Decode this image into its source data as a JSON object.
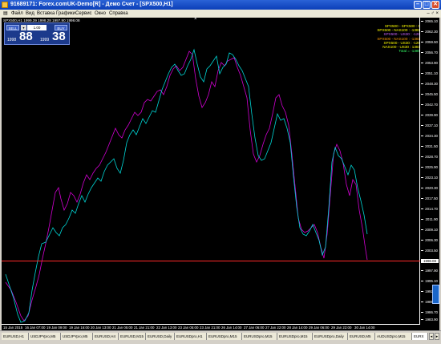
{
  "window": {
    "title": "91689171: Forex.comUK-Demo[R] - Демо Счет - [SPX500,H1]",
    "minimize": "–",
    "maximize": "□",
    "close": "✕"
  },
  "menu": {
    "items": [
      "Файл",
      "Вид",
      "Вставка",
      "Графики",
      "Сервис",
      "Окно",
      "Справка"
    ],
    "right": "– ♂ ×"
  },
  "chart": {
    "header": "SPX500,H1  1999.39 1998.28 1997.90 1998.08",
    "close_x": "×",
    "trade_panel": {
      "sell_label": "SELL",
      "buy_label": "BUY",
      "lot": "1.00",
      "lot_arrow": "▾",
      "sell_prefix": "1998",
      "sell_big": "88",
      "buy_prefix": "1999",
      "buy_big": "38"
    },
    "legend": [
      "SPX500 - SPX500 :    0",
      "SPX500 - NAS100 : -1381",
      "SPX500 - US30 :   -128",
      "SPX500 - NAS100 : -1381",
      "SPX500 - US30 :   -128",
      "NAS100 - US30 :  1381"
    ],
    "legend_total": "Total = -1385",
    "price_ticks": [
      "2065.10",
      "2062.30",
      "2059.50",
      "2056.70",
      "2053.90",
      "2051.10",
      "2048.30",
      "2045.50",
      "2042.70",
      "2039.90",
      "2037.10",
      "2034.30",
      "2031.50",
      "2028.70",
      "2025.90",
      "2023.10",
      "2020.30",
      "2017.50",
      "2014.70",
      "2011.90",
      "2009.10",
      "2006.30",
      "2003.50",
      "2000.70",
      "1997.90",
      "1995.10",
      "1992.30",
      "1989.50",
      "1986.70",
      "1983.90"
    ],
    "current_price": "1998.08",
    "time_ticks": [
      "15 Jan 2015",
      "16 Jan 07:00",
      "19 Jan 09:00",
      "19 Jan 16:00",
      "20 Jan 13:00",
      "21 Jan 05:00",
      "21 Jan 21:00",
      "22 Jan 13:00",
      "23 Jan 05:00",
      "23 Jan 21:00",
      "26 Jan 14:00",
      "27 Jan 06:00",
      "27 Jan 22:00",
      "28 Jan 14:00",
      "29 Jan 06:00",
      "29 Jan 22:00",
      "30 Jan 14:00"
    ],
    "series_colors": {
      "primary": "#d100d1",
      "secondary": "#00d6d6"
    }
  },
  "tabs": {
    "items": [
      "EURUSD,H1",
      "USDJPYpro,M5",
      "USDJPYpro,M5",
      "EURUSD,H4",
      "EURUSD,M15",
      "EURUSD,Daily",
      "EURUSDpro,H1",
      "EURUSDpro,M15",
      "EURUSDpro,M15",
      "EURUSDpro,M15",
      "EURUSDpro,Daily",
      "EURUSD,M5",
      "AUDUSDpro,M15",
      "EURX"
    ],
    "active_index": 13,
    "nav_left": "◂",
    "nav_right": "▸"
  }
}
